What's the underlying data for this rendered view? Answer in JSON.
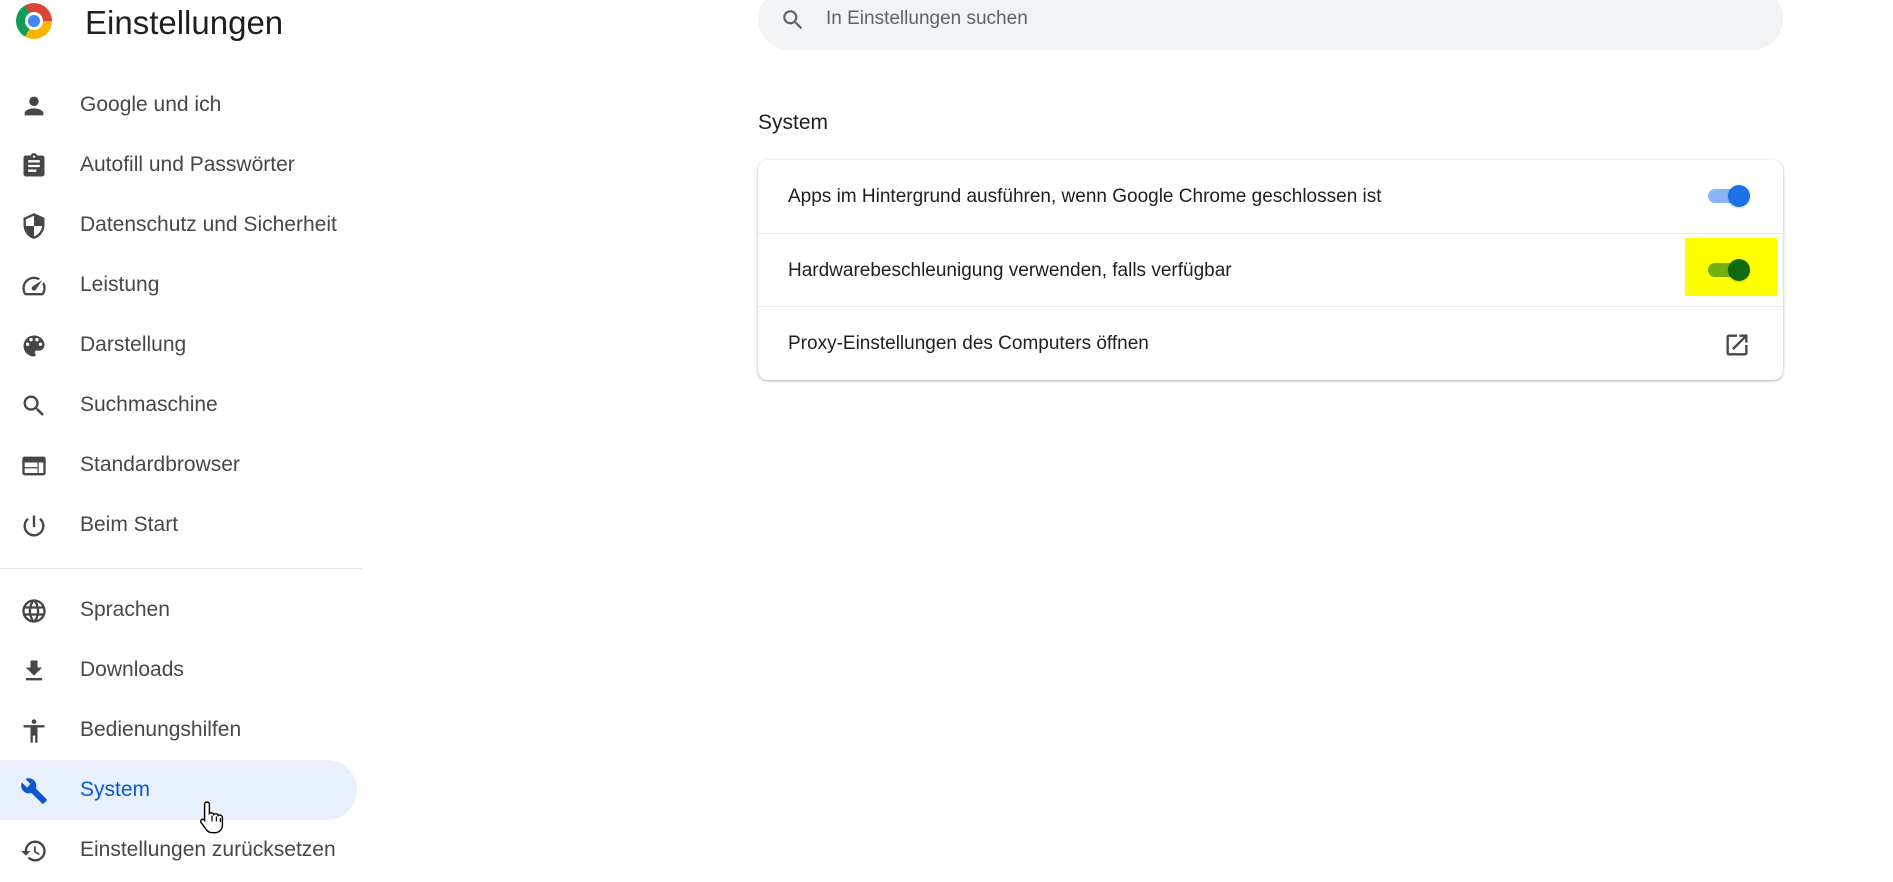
{
  "header": {
    "title": "Einstellungen",
    "logo_icon": "chrome-logo-icon"
  },
  "search": {
    "placeholder": "In Einstellungen suchen",
    "value": ""
  },
  "sidebar": {
    "items": [
      {
        "label": "Google und ich",
        "icon": "person-icon"
      },
      {
        "label": "Autofill und Passwörter",
        "icon": "clipboard-icon"
      },
      {
        "label": "Datenschutz und Sicherheit",
        "icon": "shield-icon"
      },
      {
        "label": "Leistung",
        "icon": "speedometer-icon"
      },
      {
        "label": "Darstellung",
        "icon": "palette-icon"
      },
      {
        "label": "Suchmaschine",
        "icon": "search-icon"
      },
      {
        "label": "Standardbrowser",
        "icon": "browser-window-icon"
      },
      {
        "label": "Beim Start",
        "icon": "power-icon"
      },
      {
        "label": "Sprachen",
        "icon": "globe-icon"
      },
      {
        "label": "Downloads",
        "icon": "download-icon"
      },
      {
        "label": "Bedienungshilfen",
        "icon": "accessibility-icon"
      },
      {
        "label": "System",
        "icon": "wrench-icon",
        "active": true
      },
      {
        "label": "Einstellungen zurücksetzen",
        "icon": "restore-icon"
      }
    ]
  },
  "main": {
    "section_title": "System",
    "settings": [
      {
        "label": "Apps im Hintergrund ausführen, wenn Google Chrome geschlossen ist",
        "control": "toggle",
        "checked": true
      },
      {
        "label": "Hardwarebeschleunigung verwenden, falls verfügbar",
        "control": "toggle",
        "checked": true,
        "highlighted": true
      },
      {
        "label": "Proxy-Einstellungen des Computers öffnen",
        "control": "external-link",
        "icon": "open-in-new-icon"
      }
    ]
  },
  "colors": {
    "accent": "#0b57d0",
    "active_nav_bg": "#e8f0fe",
    "toggle_on": "#1a73e8",
    "highlight": "#ffff00"
  }
}
